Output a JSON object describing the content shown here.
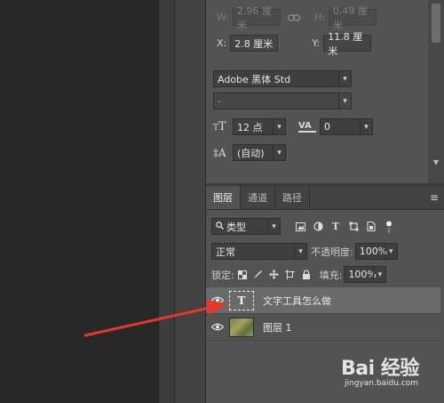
{
  "properties": {
    "w_label": "W:",
    "w_value": "2.96 厘米",
    "link_icon": "link-icon",
    "h_label": "H:",
    "h_value": "0.49 厘米",
    "x_label": "X:",
    "x_value": "2.8 厘米",
    "y_label": "Y:",
    "y_value": "11.8 厘米",
    "font_family": "Adobe 黑体 Std",
    "font_style": "-",
    "font_size": "12 点",
    "tracking": "0",
    "leading": "(自动)"
  },
  "layers_panel": {
    "tabs": [
      "图层",
      "通道",
      "路径"
    ],
    "filter_type": "类型",
    "blend_mode": "正常",
    "opacity_label": "不透明度:",
    "opacity_value": "100%",
    "lock_label": "锁定:",
    "fill_label": "填充:",
    "fill_value": "100%",
    "layers": [
      {
        "name": "文字工具怎么做",
        "type": "text",
        "thumb_glyph": "T",
        "selected": true
      },
      {
        "name": "图层 1",
        "type": "image",
        "selected": false
      }
    ]
  },
  "watermark": {
    "main": "Bai 经验",
    "sub": "jingyan.baidu.com"
  },
  "colors": {
    "panel_bg": "#535353",
    "canvas_bg": "#282828",
    "arrow": "#e8362b",
    "selected_row": "#6a6a6a"
  }
}
